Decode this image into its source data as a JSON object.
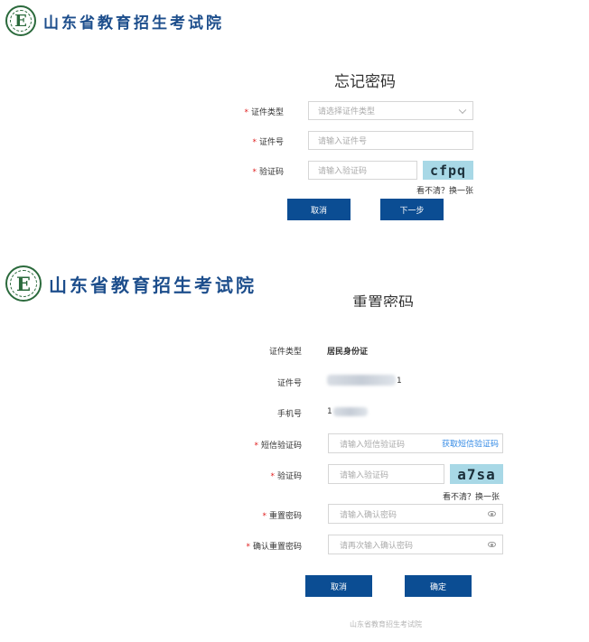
{
  "brand": {
    "emblem_letter": "E",
    "name": "山东省教育招生考试院",
    "emblem_color": "#2b6a3c",
    "name_color": "#1d4e8c"
  },
  "forgot": {
    "title": "忘记密码",
    "fields": {
      "id_type": {
        "label": "证件类型",
        "placeholder": "请选择证件类型"
      },
      "id_number": {
        "label": "证件号",
        "placeholder": "请输入证件号"
      },
      "captcha": {
        "label": "验证码",
        "placeholder": "请输入验证码",
        "image_text": "cfpq"
      }
    },
    "refresh_text": "看不清？换一张",
    "cancel_label": "取消",
    "next_label": "下一步"
  },
  "reset": {
    "title": "重置密码",
    "fields": {
      "id_type": {
        "label": "证件类型",
        "value": "居民身份证"
      },
      "id_number": {
        "label": "证件号",
        "value_tail": "1"
      },
      "phone": {
        "label": "手机号",
        "value_head": "1"
      },
      "sms_code": {
        "label": "短信验证码",
        "placeholder": "请输入短信验证码",
        "link": "获取短信验证码"
      },
      "captcha": {
        "label": "验证码",
        "placeholder": "请输入验证码",
        "image_text": "a7sa"
      },
      "new_password": {
        "label": "重置密码",
        "placeholder": "请输入确认密码"
      },
      "confirm_password": {
        "label": "确认重置密码",
        "placeholder": "请再次输入确认密码"
      }
    },
    "refresh_text": "看不清？换一张",
    "cancel_label": "取消",
    "confirm_label": "确定"
  },
  "footer": "山东省教育招生考试院",
  "colors": {
    "primary_button": "#0b4d93",
    "link": "#3a8ee6",
    "required": "#e02020"
  }
}
